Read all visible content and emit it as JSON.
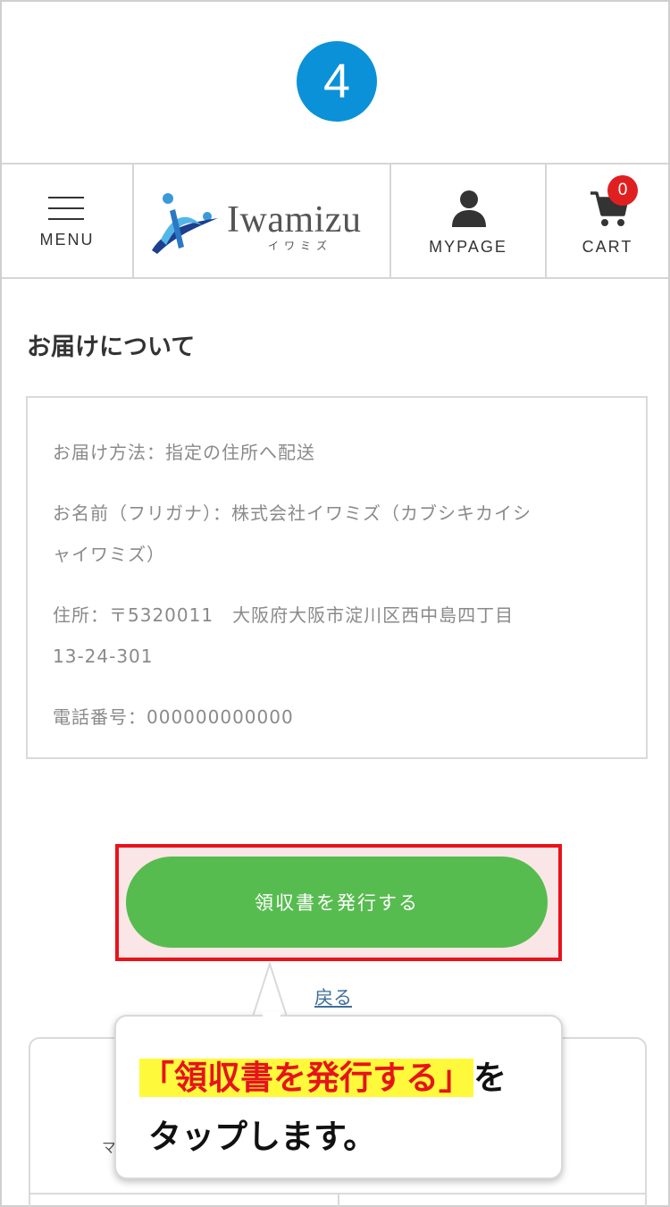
{
  "step": {
    "number": "4",
    "color": "#0a91d8"
  },
  "header": {
    "menu_label": "MENU",
    "logo_text": "Iwamizu",
    "logo_sub": "イワミズ",
    "mypage_label": "MYPAGE",
    "cart_label": "CART",
    "cart_count": "0",
    "badge_color": "#e02020"
  },
  "delivery": {
    "title": "お届けについて",
    "method": "お届け方法：指定の住所へ配送",
    "name_line1": "お名前（フリガナ）：株式会社イワミズ（カブシキカイシ",
    "name_line2": "ャイワミズ）",
    "address_line1": "住所：〒5320011　大阪府大阪市淀川区西中島四丁目",
    "address_line2": "13-24-301",
    "phone": "電話番号：000000000000"
  },
  "actions": {
    "issue_receipt_label": "領収書を発行する",
    "back_label": "戻る",
    "button_color": "#57bc4f"
  },
  "bottom_card": {
    "peek_text": "マ"
  },
  "callout": {
    "highlight_text": "「領収書を発行する」",
    "suffix": "を",
    "line2": "タップします。",
    "highlight_color": "#fff93b",
    "accent_color": "#e5141b"
  }
}
